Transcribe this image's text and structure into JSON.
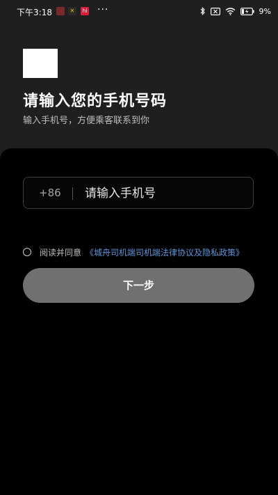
{
  "status_bar": {
    "time": "下午3:18",
    "app_icon_3_text": "hi",
    "overflow_dots": "···",
    "battery_percent": "9%"
  },
  "header": {
    "title": "请输入您的手机号码",
    "subtitle": "输入手机号，方便乘客联系到你"
  },
  "form": {
    "country_code": "+86",
    "phone_placeholder": "请输入手机号",
    "phone_value": ""
  },
  "agreement": {
    "prefix": "阅读并同意",
    "link": "《城舟司机端司机端法律协议及隐私政策》"
  },
  "actions": {
    "next_label": "下一步"
  },
  "colors": {
    "background": "#1f1f1f",
    "sheet": "#000000",
    "button": "#707070",
    "link": "#5f93d6"
  }
}
